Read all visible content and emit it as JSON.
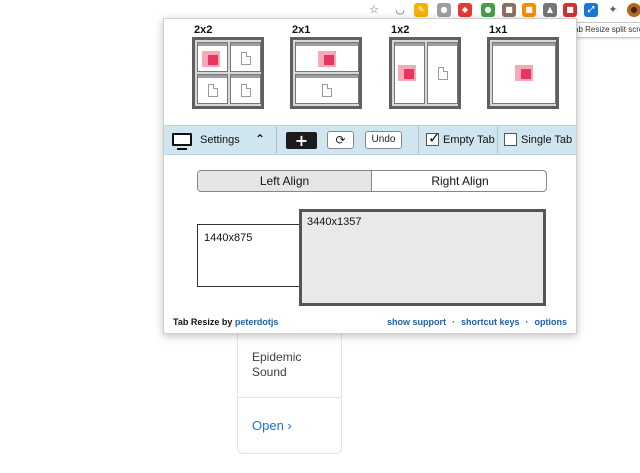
{
  "browser": {
    "tooltip": "Tab Resize split scre",
    "extensions": [
      {
        "name": "pocket-icon",
        "glyph": "◡",
        "bg": ""
      },
      {
        "name": "extension-pencil-icon",
        "glyph": "✎",
        "bg": "#f4b400"
      },
      {
        "name": "extension-circle-icon",
        "glyph": "●",
        "bg": "#9e9e9e"
      },
      {
        "name": "extension-red-icon",
        "glyph": "◆",
        "bg": "#e53935"
      },
      {
        "name": "extension-green-icon",
        "glyph": "●",
        "bg": "#43a047"
      },
      {
        "name": "extension-brown-icon",
        "glyph": "■",
        "bg": "#8d6e63"
      },
      {
        "name": "extension-orange-icon",
        "glyph": "■",
        "bg": "#fb8c00"
      },
      {
        "name": "extension-gray-icon",
        "glyph": "▲",
        "bg": "#757575"
      },
      {
        "name": "extension-red-square-icon",
        "glyph": "■",
        "bg": "#d32f2f"
      },
      {
        "name": "tab-resize-icon",
        "glyph": "⤢",
        "bg": "#1976d2"
      },
      {
        "name": "extensions-puzzle-icon",
        "glyph": "✦",
        "bg": ""
      },
      {
        "name": "profile-avatar-icon",
        "glyph": "●",
        "bg": "#b5651d"
      },
      {
        "name": "browser-menu-icon",
        "glyph": "⋮",
        "bg": ""
      }
    ]
  },
  "popup": {
    "layouts": [
      {
        "key": "2x2",
        "label": "2x2"
      },
      {
        "key": "2x1",
        "label": "2x1"
      },
      {
        "key": "1x2",
        "label": "1x2"
      },
      {
        "key": "1x1",
        "label": "1x1"
      }
    ],
    "controls": {
      "settings_label": "Settings",
      "undo_label": "Undo",
      "empty_tab_label": "Empty Tab",
      "empty_tab_checked": true,
      "single_tab_label": "Single Tab",
      "single_tab_checked": false
    },
    "align": {
      "left_label": "Left Align",
      "right_label": "Right Align",
      "selected": "left"
    },
    "displays": [
      {
        "label": "1440x875"
      },
      {
        "label": "3440x1357"
      }
    ],
    "footer": {
      "credit_prefix": "Tab Resize by",
      "author": "peterdotjs",
      "links": [
        "show support",
        "shortcut keys",
        "options"
      ]
    }
  },
  "background_card": {
    "name": "Epidemic Sound",
    "open_label": "Open ›"
  },
  "colors": {
    "pink_dark": "#e8365f",
    "pink_light": "#f7a8bb",
    "control_bar": "#cfe6f1",
    "link": "#1f5ea8"
  }
}
